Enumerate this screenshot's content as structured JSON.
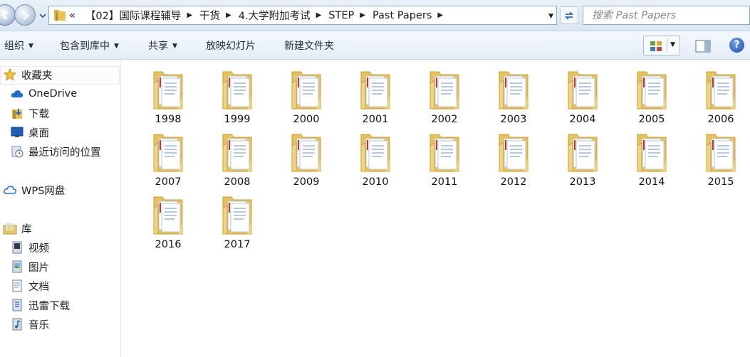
{
  "address_bar": {
    "overflow": "«",
    "crumbs": [
      "【02】国际课程辅导",
      "干货",
      "4.大学附加考试",
      "STEP",
      "Past Papers"
    ],
    "search_placeholder": "搜索 Past Papers"
  },
  "toolbar": {
    "organize": "组织",
    "include_in_library": "包含到库中",
    "share": "共享",
    "slideshow": "放映幻灯片",
    "new_folder": "新建文件夹",
    "help": "?"
  },
  "nav_pane": {
    "favorites": "收藏夹",
    "onedrive": "OneDrive",
    "downloads": "下载",
    "desktop": "桌面",
    "recent": "最近访问的位置",
    "wps": "WPS网盘",
    "libraries": "库",
    "videos": "视频",
    "pictures": "图片",
    "documents": "文档",
    "xunlei": "迅雷下载",
    "music": "音乐"
  },
  "folders": [
    "1998",
    "1999",
    "2000",
    "2001",
    "2002",
    "2003",
    "2004",
    "2005",
    "2006",
    "2007",
    "2008",
    "2009",
    "2010",
    "2011",
    "2012",
    "2013",
    "2014",
    "2015",
    "2016",
    "2017"
  ],
  "colors": {
    "folder": "#f4d77a",
    "accent": "#3a6fb5"
  }
}
